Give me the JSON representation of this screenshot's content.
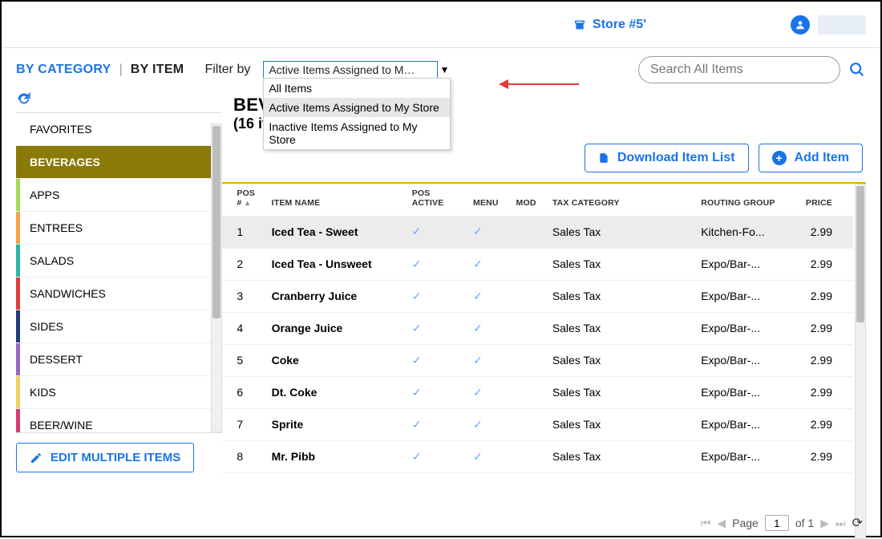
{
  "header": {
    "store_label": "Store #5'"
  },
  "tabs": {
    "by_category": "BY CATEGORY",
    "by_item": "BY ITEM"
  },
  "filter": {
    "label": "Filter by",
    "selected": "Active Items Assigned to My Store",
    "options": [
      "All Items",
      "Active Items Assigned to My Store",
      "Inactive Items Assigned to My Store"
    ]
  },
  "search": {
    "placeholder": "Search All Items"
  },
  "heading": {
    "title": "BEVERAGES",
    "subtitle": "(16 items)"
  },
  "actions": {
    "download": "Download Item List",
    "add": "Add Item"
  },
  "categories": [
    {
      "label": "FAVORITES",
      "color": "#ffffff",
      "selected": false
    },
    {
      "label": "BEVERAGES",
      "color": "#8a7a0a",
      "selected": true
    },
    {
      "label": "APPS",
      "color": "#a6d95a",
      "selected": false
    },
    {
      "label": "ENTREES",
      "color": "#f4a24a",
      "selected": false
    },
    {
      "label": "SALADS",
      "color": "#2ab5a0",
      "selected": false
    },
    {
      "label": "SANDWICHES",
      "color": "#e23b3b",
      "selected": false
    },
    {
      "label": "SIDES",
      "color": "#1f3d7a",
      "selected": false
    },
    {
      "label": "DESSERT",
      "color": "#9668c2",
      "selected": false
    },
    {
      "label": "KIDS",
      "color": "#f0d060",
      "selected": false
    },
    {
      "label": "BEER/WINE",
      "color": "#d93b77",
      "selected": false
    }
  ],
  "edit_multi": "EDIT MULTIPLE ITEMS",
  "columns": {
    "pos_num": "POS #",
    "item_name": "ITEM NAME",
    "pos_active": "POS ACTIVE",
    "menu": "MENU",
    "mod": "MOD",
    "tax_category": "TAX CATEGORY",
    "routing_group": "ROUTING GROUP",
    "price": "PRICE"
  },
  "rows": [
    {
      "pos": "1",
      "name": "Iced Tea - Sweet",
      "pos_active": true,
      "menu": true,
      "mod": false,
      "tax": "Sales Tax",
      "routing": "Kitchen-Fo...",
      "price": "2.99",
      "selected": true
    },
    {
      "pos": "2",
      "name": "Iced Tea - Unsweet",
      "pos_active": true,
      "menu": true,
      "mod": false,
      "tax": "Sales Tax",
      "routing": "Expo/Bar-...",
      "price": "2.99",
      "selected": false
    },
    {
      "pos": "3",
      "name": "Cranberry Juice",
      "pos_active": true,
      "menu": true,
      "mod": false,
      "tax": "Sales Tax",
      "routing": "Expo/Bar-...",
      "price": "2.99",
      "selected": false
    },
    {
      "pos": "4",
      "name": "Orange Juice",
      "pos_active": true,
      "menu": true,
      "mod": false,
      "tax": "Sales Tax",
      "routing": "Expo/Bar-...",
      "price": "2.99",
      "selected": false
    },
    {
      "pos": "5",
      "name": "Coke",
      "pos_active": true,
      "menu": true,
      "mod": false,
      "tax": "Sales Tax",
      "routing": "Expo/Bar-...",
      "price": "2.99",
      "selected": false
    },
    {
      "pos": "6",
      "name": "Dt. Coke",
      "pos_active": true,
      "menu": true,
      "mod": false,
      "tax": "Sales Tax",
      "routing": "Expo/Bar-...",
      "price": "2.99",
      "selected": false
    },
    {
      "pos": "7",
      "name": "Sprite",
      "pos_active": true,
      "menu": true,
      "mod": false,
      "tax": "Sales Tax",
      "routing": "Expo/Bar-...",
      "price": "2.99",
      "selected": false
    },
    {
      "pos": "8",
      "name": "Mr. Pibb",
      "pos_active": true,
      "menu": true,
      "mod": false,
      "tax": "Sales Tax",
      "routing": "Expo/Bar-...",
      "price": "2.99",
      "selected": false
    }
  ],
  "pager": {
    "page_label": "Page",
    "current": "1",
    "total_label": "of 1"
  }
}
